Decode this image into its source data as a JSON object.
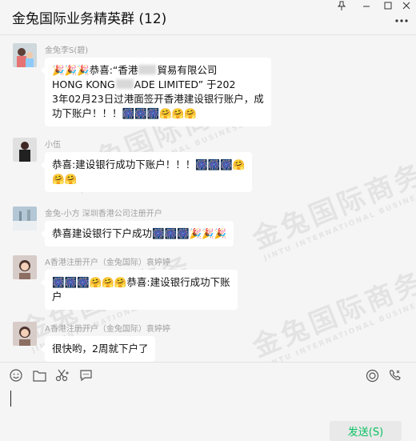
{
  "window": {
    "title": "金兔国际业务精英群 (12)"
  },
  "icons": {
    "pin": "pin-icon",
    "minimize": "minimize-icon",
    "maximize": "maximize-icon",
    "close": "close-icon",
    "more": "more-icon",
    "party_popper": "party-popper-emoji",
    "firecracker": "firework-emoji",
    "hugging_face": "hugging-face-emoji"
  },
  "messages": [
    {
      "sender": "金兔李S(碧)",
      "lines": [
        [
          "🎉🎉🎉恭喜:“香港",
          "[blur]",
          "貿易有限公司"
        ],
        [
          "HONG KONG",
          "[blur]",
          "ADE LIMITED”  于202"
        ],
        [
          "3年02月23日过港面签开香港建设银行账户，成"
        ],
        [
          "功下账户！！！🎆🎆🎆🤗🤗🤗"
        ]
      ]
    },
    {
      "sender": "小伍",
      "lines": [
        [
          "恭喜:建设银行成功下账户！！！🎆🎆🎆🤗"
        ],
        [
          "🤗🤗"
        ]
      ]
    },
    {
      "sender": "金兔-小方  深圳香港公司注册开户",
      "lines": [
        [
          "恭喜建设银行下户成功🎆🎆🎆🎉🎉🎉"
        ]
      ]
    },
    {
      "sender": "A香港注册开户（金兔国际）袁婷婷",
      "lines": [
        [
          "🎆🎆🎆🤗🤗🤗恭喜:建设银行成功下账"
        ],
        [
          "户"
        ]
      ]
    },
    {
      "sender": "A香港注册开户（金兔国际）袁婷婷",
      "lines": [
        [
          "很快哟，2周就下户了"
        ]
      ]
    }
  ],
  "watermark": {
    "text": "金兔国际商务",
    "subtext": "JINTU INTERNATIONAL BUSINESS"
  },
  "toolbar": {
    "emoji": "emoji-icon",
    "folder": "folder-icon",
    "screenshot": "scissors-icon",
    "chat_history": "chat-bubble-icon",
    "live": "live-icon",
    "voice_call": "phone-icon"
  },
  "input": {
    "value": ""
  },
  "send_button": {
    "label": "发送(S)"
  },
  "colors": {
    "background": "#f5f5f5",
    "bubble": "#ffffff",
    "send_text": "#07c160"
  }
}
